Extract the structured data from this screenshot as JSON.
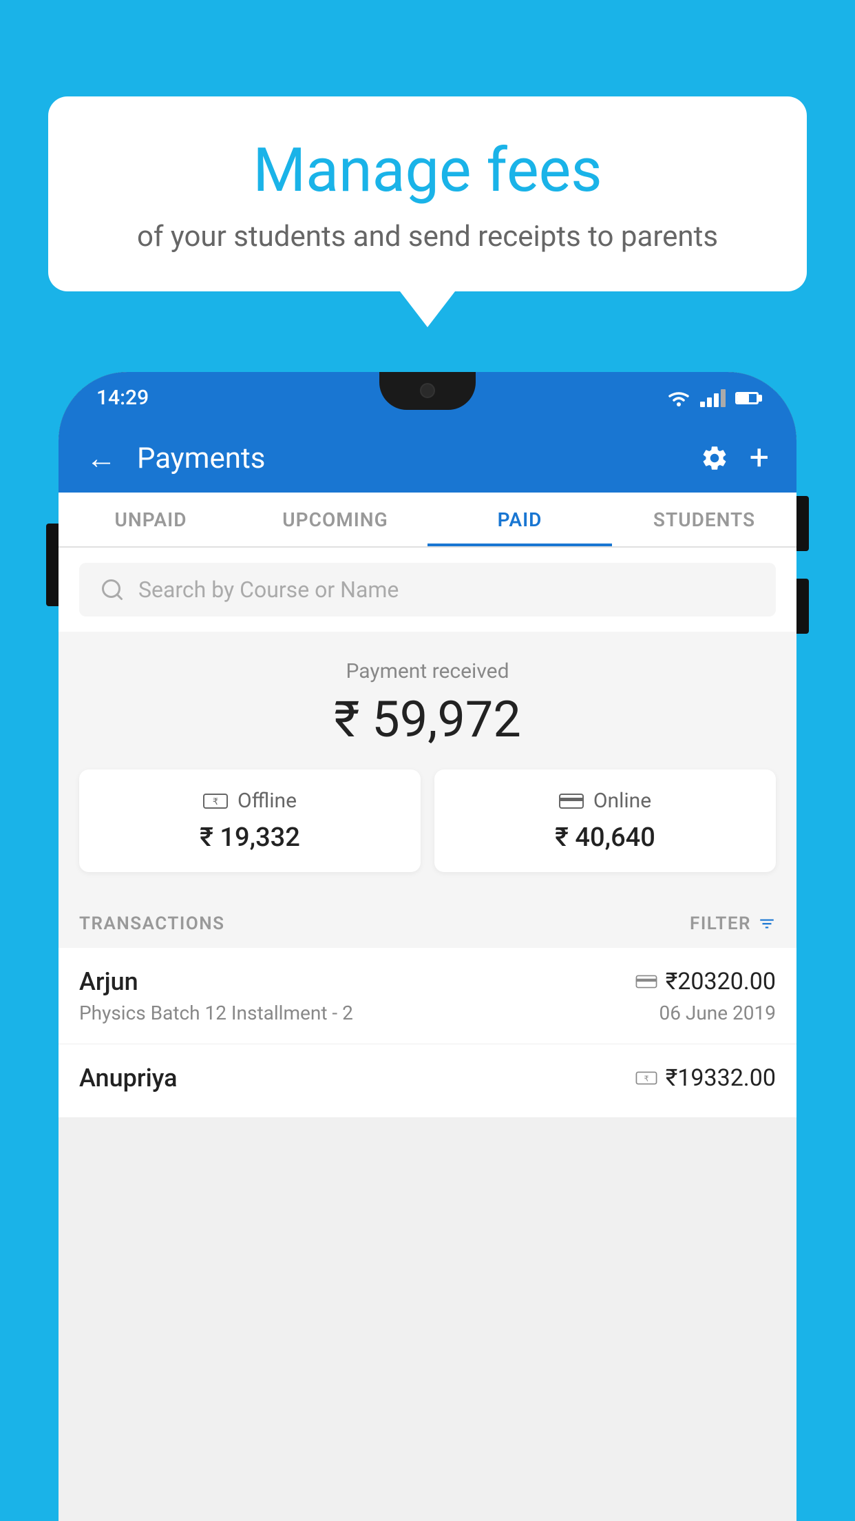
{
  "background_color": "#1ab3e8",
  "speech_bubble": {
    "title": "Manage fees",
    "subtitle": "of your students and send receipts to parents"
  },
  "status_bar": {
    "time": "14:29"
  },
  "app_header": {
    "title": "Payments",
    "back_label": "←",
    "plus_label": "+"
  },
  "tabs": [
    {
      "label": "UNPAID",
      "active": false
    },
    {
      "label": "UPCOMING",
      "active": false
    },
    {
      "label": "PAID",
      "active": true
    },
    {
      "label": "STUDENTS",
      "active": false
    }
  ],
  "search": {
    "placeholder": "Search by Course or Name"
  },
  "payment_summary": {
    "received_label": "Payment received",
    "total_amount": "₹ 59,972",
    "offline": {
      "label": "Offline",
      "amount": "₹ 19,332"
    },
    "online": {
      "label": "Online",
      "amount": "₹ 40,640"
    }
  },
  "transactions_section": {
    "label": "TRANSACTIONS",
    "filter_label": "FILTER"
  },
  "transactions": [
    {
      "name": "Arjun",
      "amount": "₹20320.00",
      "course": "Physics Batch 12 Installment - 2",
      "date": "06 June 2019",
      "payment_type": "online"
    },
    {
      "name": "Anupriya",
      "amount": "₹19332.00",
      "course": "",
      "date": "",
      "payment_type": "offline"
    }
  ]
}
